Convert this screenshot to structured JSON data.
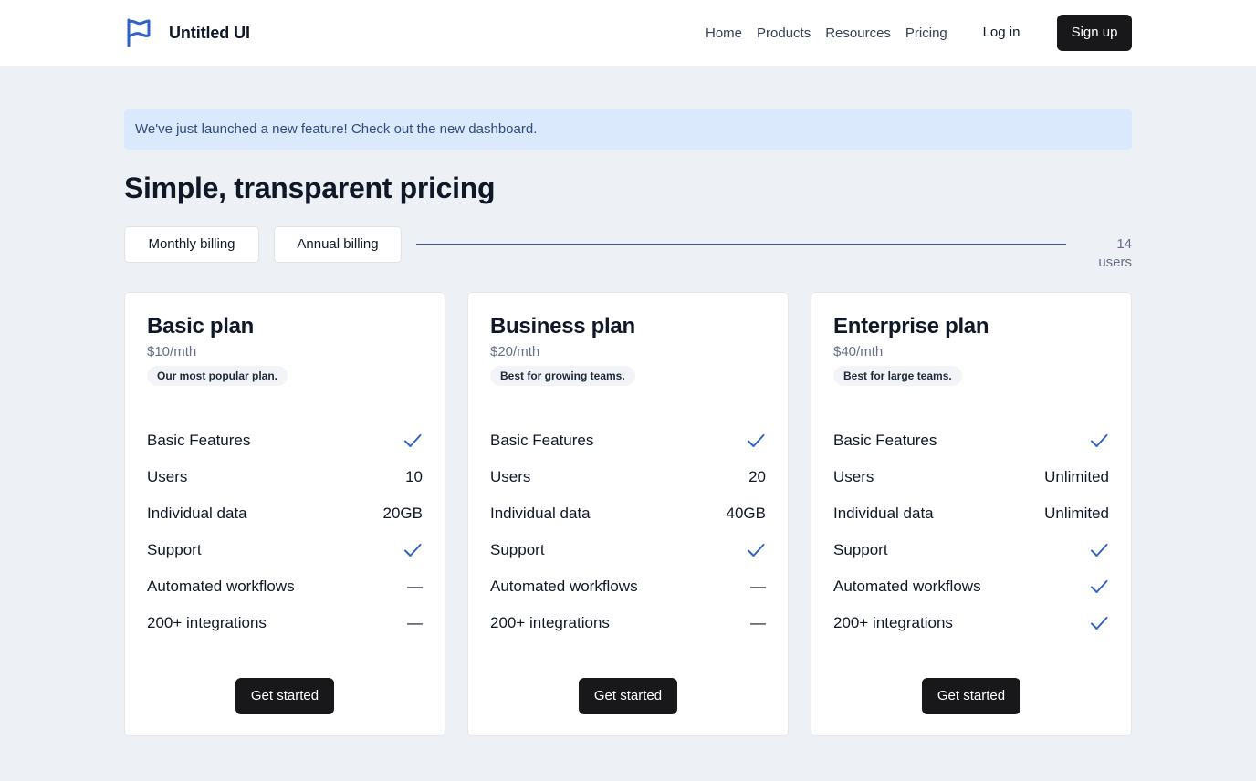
{
  "header": {
    "brand": "Untitled UI",
    "nav": [
      "Home",
      "Products",
      "Resources",
      "Pricing"
    ],
    "login": "Log in",
    "signup": "Sign up"
  },
  "banner": "We've just launched a new feature! Check out the new dashboard.",
  "heading": "Simple, transparent pricing",
  "billing": {
    "monthly": "Monthly billing",
    "annual": "Annual billing",
    "users": "14 users"
  },
  "plans": [
    {
      "name": "Basic plan",
      "price": "$10/mth",
      "badge": "Our most popular plan.",
      "features": [
        {
          "label": "Basic Features",
          "value": "check"
        },
        {
          "label": "Users",
          "value": "10"
        },
        {
          "label": "Individual data",
          "value": "20GB"
        },
        {
          "label": "Support",
          "value": "check"
        },
        {
          "label": "Automated workflows",
          "value": "—"
        },
        {
          "label": "200+ integrations",
          "value": "—"
        }
      ],
      "cta": "Get started"
    },
    {
      "name": "Business plan",
      "price": "$20/mth",
      "badge": "Best for growing teams.",
      "features": [
        {
          "label": "Basic Features",
          "value": "check"
        },
        {
          "label": "Users",
          "value": "20"
        },
        {
          "label": "Individual data",
          "value": "40GB"
        },
        {
          "label": "Support",
          "value": "check"
        },
        {
          "label": "Automated workflows",
          "value": "—"
        },
        {
          "label": "200+ integrations",
          "value": "—"
        }
      ],
      "cta": "Get started"
    },
    {
      "name": "Enterprise plan",
      "price": "$40/mth",
      "badge": "Best for large teams.",
      "features": [
        {
          "label": "Basic Features",
          "value": "check"
        },
        {
          "label": "Users",
          "value": "Unlimited"
        },
        {
          "label": "Individual data",
          "value": "Unlimited"
        },
        {
          "label": "Support",
          "value": "check"
        },
        {
          "label": "Automated workflows",
          "value": "check"
        },
        {
          "label": "200+ integrations",
          "value": "check"
        }
      ],
      "cta": "Get started"
    }
  ],
  "colors": {
    "accent": "#2f62c9",
    "dark_button": "#18181b",
    "banner_bg": "#dbe9fd",
    "page_bg": "#edf1f5"
  },
  "icons": {
    "logo": "flag-icon",
    "included": "check-icon"
  }
}
